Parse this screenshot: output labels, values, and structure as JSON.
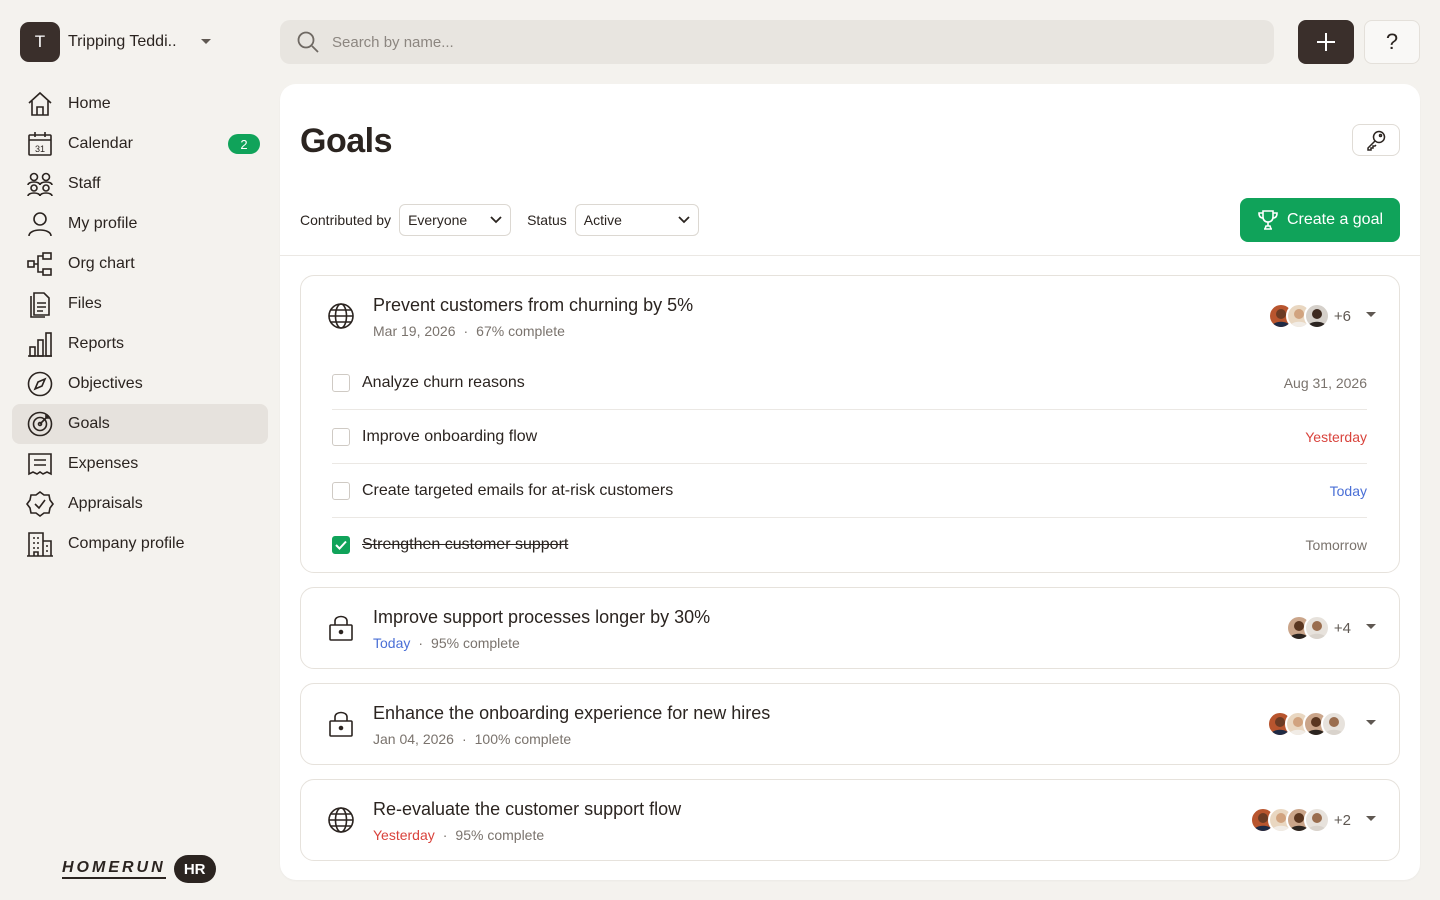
{
  "workspace": {
    "initial": "T",
    "name": "Tripping Teddi.."
  },
  "search": {
    "placeholder": "Search by name..."
  },
  "topbar": {
    "help_label": "?"
  },
  "sidebar": {
    "items": [
      {
        "label": "Home",
        "icon": "home-icon"
      },
      {
        "label": "Calendar",
        "icon": "calendar-icon",
        "badge": "2"
      },
      {
        "label": "Staff",
        "icon": "staff-icon"
      },
      {
        "label": "My profile",
        "icon": "user-icon"
      },
      {
        "label": "Org chart",
        "icon": "org-chart-icon"
      },
      {
        "label": "Files",
        "icon": "files-icon"
      },
      {
        "label": "Reports",
        "icon": "reports-icon"
      },
      {
        "label": "Objectives",
        "icon": "compass-icon"
      },
      {
        "label": "Goals",
        "icon": "target-icon",
        "active": true
      },
      {
        "label": "Expenses",
        "icon": "receipt-icon"
      },
      {
        "label": "Appraisals",
        "icon": "badge-check-icon"
      },
      {
        "label": "Company profile",
        "icon": "building-icon"
      }
    ],
    "calendar_icon_day": "31"
  },
  "brand": {
    "wordmark": "HOMERUN",
    "tag": "HR"
  },
  "main": {
    "title": "Goals",
    "filters": {
      "contributed_label": "Contributed by",
      "contributed_value": "Everyone",
      "status_label": "Status",
      "status_value": "Active"
    },
    "create_label": "Create a goal",
    "accent": "#10a35a"
  },
  "goals": [
    {
      "title": "Prevent customers from churning by 5%",
      "date": "Mar 19, 2026",
      "progress": "67% complete",
      "scope": "globe-icon",
      "extra": "+6",
      "tasks": [
        {
          "label": "Analyze churn reasons",
          "due": "Aug 31, 2026",
          "done": false
        },
        {
          "label": "Improve onboarding flow",
          "due": "Yesterday",
          "done": false
        },
        {
          "label": "Create targeted emails for at-risk customers",
          "due": "Today",
          "done": false
        },
        {
          "label": "Strengthen customer support",
          "due": "Tomorrow",
          "done": true
        }
      ]
    },
    {
      "title": "Improve support processes longer by 30%",
      "date": "Today",
      "progress": "95% complete",
      "scope": "lock-icon",
      "extra": "+4"
    },
    {
      "title": "Enhance the onboarding experience for new hires",
      "date": "Jan 04, 2026",
      "progress": "100% complete",
      "scope": "lock-icon",
      "extra": ""
    },
    {
      "title": "Re-evaluate the customer support flow",
      "date": "Yesterday",
      "progress": "95% complete",
      "scope": "globe-icon",
      "extra": "+2"
    }
  ],
  "colors": {
    "today": "#4a6fd6",
    "yesterday": "#d9433c",
    "dark": "#3a2f2b"
  }
}
